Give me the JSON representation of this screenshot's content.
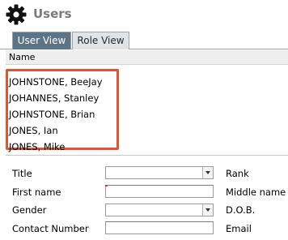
{
  "header": {
    "title": "Users",
    "icon": "gear-icon"
  },
  "tabs": [
    {
      "label": "User View",
      "active": true
    },
    {
      "label": "Role View",
      "active": false
    }
  ],
  "list": {
    "column_header": "Name",
    "items": [
      "JOHNSTONE, BeeJay",
      "JOHANNES, Stanley",
      "JOHNSTONE, Brian",
      "JONES, Ian",
      "JONES, Mike"
    ],
    "highlight_color": "#e4532f"
  },
  "form": {
    "title_label": "Title",
    "title_value": "",
    "first_name_label": "First name",
    "first_name_value": "",
    "gender_label": "Gender",
    "gender_value": "",
    "contact_number_label": "Contact Number",
    "contact_number_value": "",
    "rank_label": "Rank",
    "middle_name_label": "Middle name",
    "dob_label": "D.O.B.",
    "email_label": "Email"
  },
  "colors": {
    "active_tab": "#5c7485",
    "inactive_tab": "#e1e4e6",
    "title_text": "#7a7a7a"
  }
}
